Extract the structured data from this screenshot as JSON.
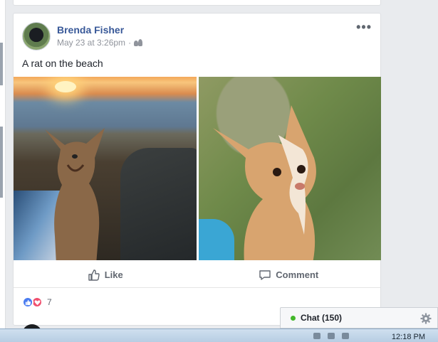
{
  "post": {
    "author": "Brenda Fisher",
    "timestamp": "May 23 at 3:26pm",
    "separator": "·",
    "audience_icon": "friends-icon",
    "more_label": "•••",
    "text": "A rat on the beach",
    "photos": [
      {
        "icon": "photo",
        "subject": "chihuahua-at-sunset-beach"
      },
      {
        "icon": "photo",
        "subject": "chihuahua-on-grass"
      }
    ],
    "actions": {
      "like_label": "Like",
      "comment_label": "Comment"
    },
    "reactions": {
      "types": [
        "like",
        "love"
      ],
      "count": "7"
    }
  },
  "chat": {
    "label": "Chat (150)",
    "status_color": "#42b72a"
  },
  "taskbar": {
    "time": "12:18 PM"
  },
  "colors": {
    "author_link": "#385898",
    "background": "#e9ebee",
    "like_blue": "#4a7cf0",
    "love_red": "#f0506e"
  }
}
